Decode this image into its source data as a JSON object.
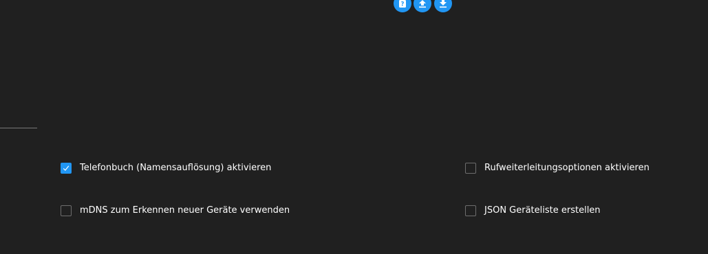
{
  "toolbar": {
    "buttons": [
      {
        "name": "help",
        "icon": "help-icon"
      },
      {
        "name": "upload",
        "icon": "upload-icon"
      },
      {
        "name": "download",
        "icon": "download-icon"
      }
    ]
  },
  "options": [
    {
      "label": "Telefonbuch (Namensauflösung) aktivieren",
      "checked": true
    },
    {
      "label": "mDNS zum Erkennen neuer Geräte verwenden",
      "checked": false
    },
    {
      "label": "Rufweiterleitungsoptionen aktivieren",
      "checked": false
    },
    {
      "label": "JSON Geräteliste erstellen",
      "checked": false
    }
  ],
  "colors": {
    "background": "#202020",
    "accent": "#2196f3",
    "text": "#ffffff",
    "checkbox_border": "#6e6e6e"
  }
}
